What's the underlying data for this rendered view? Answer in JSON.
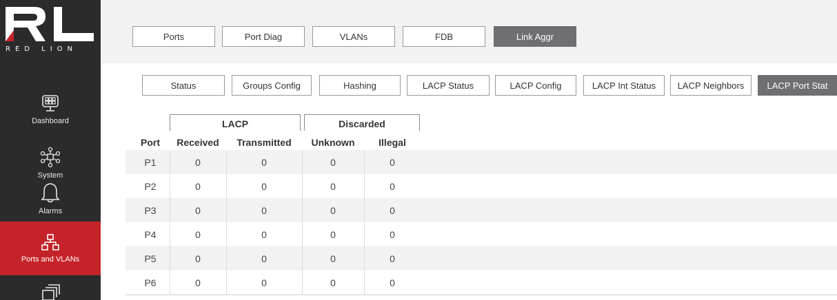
{
  "brand": {
    "logo_text": "RED LION"
  },
  "sidebar": {
    "items": [
      {
        "label": "Dashboard",
        "icon": "dashboard-icon",
        "active": false
      },
      {
        "label": "System",
        "icon": "system-icon",
        "active": false
      },
      {
        "label": "Alarms",
        "icon": "bell-icon",
        "active": false
      },
      {
        "label": "Ports and VLANs",
        "icon": "network-icon",
        "active": true
      },
      {
        "label": "",
        "icon": "stack-icon",
        "active": false
      }
    ]
  },
  "top_tabs": [
    {
      "label": "Ports",
      "active": false
    },
    {
      "label": "Port Diag",
      "active": false
    },
    {
      "label": "VLANs",
      "active": false
    },
    {
      "label": "FDB",
      "active": false
    },
    {
      "label": "Link Aggr",
      "active": true
    }
  ],
  "sub_tabs": [
    {
      "label": "Status",
      "active": false
    },
    {
      "label": "Groups Config",
      "active": false
    },
    {
      "label": "Hashing",
      "active": false
    },
    {
      "label": "LACP Status",
      "active": false
    },
    {
      "label": "LACP Config",
      "active": false
    },
    {
      "label": "LACP Int Status",
      "active": false
    },
    {
      "label": "LACP Neighbors",
      "active": false
    },
    {
      "label": "LACP Port Stat",
      "active": true
    }
  ],
  "table": {
    "groups": [
      "LACP",
      "Discarded"
    ],
    "columns": [
      "Port",
      "Received",
      "Transmitted",
      "Unknown",
      "Illegal"
    ],
    "rows": [
      [
        "P1",
        "0",
        "0",
        "0",
        "0"
      ],
      [
        "P2",
        "0",
        "0",
        "0",
        "0"
      ],
      [
        "P3",
        "0",
        "0",
        "0",
        "0"
      ],
      [
        "P4",
        "0",
        "0",
        "0",
        "0"
      ],
      [
        "P5",
        "0",
        "0",
        "0",
        "0"
      ],
      [
        "P6",
        "0",
        "0",
        "0",
        "0"
      ]
    ]
  },
  "colors": {
    "accent": "#c5232a",
    "sidebar": "#2b2b2b",
    "active_tab": "#6e6e73"
  }
}
